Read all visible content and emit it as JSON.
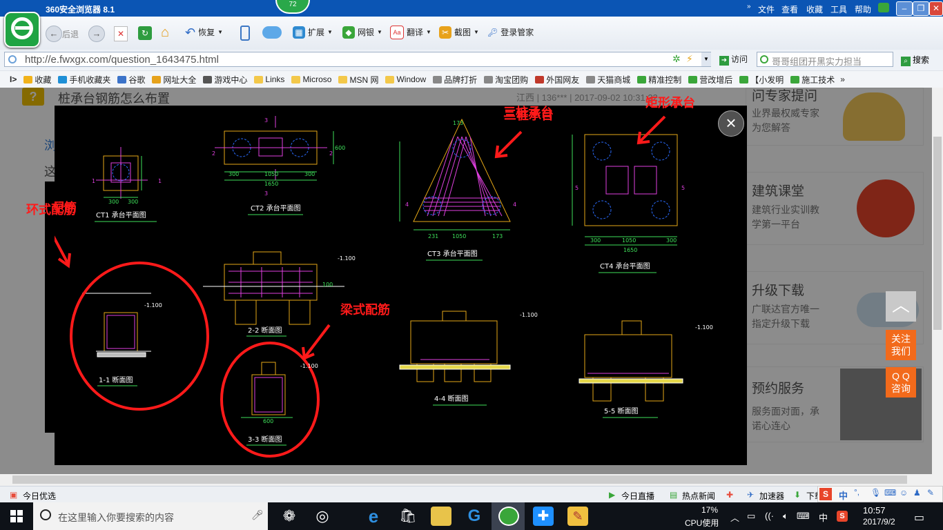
{
  "browser": {
    "title": "360安全浏览器 8.1",
    "badge": "72",
    "menu": [
      "文件",
      "查看",
      "收藏",
      "工具",
      "帮助"
    ],
    "nav": {
      "back": "后退",
      "restore": "恢复",
      "extend": "扩展",
      "bank": "网银",
      "translate": "翻译",
      "screenshot": "截图",
      "login": "登录管家"
    },
    "url": "http://e.fwxgx.com/question_1643475.html",
    "visit": "访问",
    "search_placeholder": "哥哥组团开黑实力担当",
    "search_btn": "搜索"
  },
  "bookmarks": [
    "收藏",
    "手机收藏夹",
    "谷歌",
    "网址大全",
    "游戏中心",
    "Links",
    "Microso",
    "MSN 网",
    "Window",
    "品牌打折",
    "淘宝团购",
    "外国网友",
    "天猫商城",
    "精准控制",
    "营改增后",
    "【小发明",
    "施工技术"
  ],
  "bookmark_colors": [
    "#f1b21a",
    "#1e8fd6",
    "#3b73c9",
    "#e6a21b",
    "#555555",
    "#f3c84a",
    "#f3c84a",
    "#f3c84a",
    "#f3c84a",
    "#888888",
    "#888888",
    "#c0392b",
    "#888888",
    "#3aa63a",
    "#3aa63a",
    "#3aa63a",
    "#3aa63a"
  ],
  "page": {
    "question": "桩承台钢筋怎么布置",
    "meta": "江西 | 136*** | 2017-09-02 10:31:32",
    "left_a": "浏",
    "left_b": "这",
    "side": [
      {
        "title": "问专家提问",
        "sub1": "业界最权威专家",
        "sub2": "为您解答"
      },
      {
        "title": "建筑课堂",
        "sub1": "建筑行业实训教",
        "sub2": "学第一平台"
      },
      {
        "title": "升级下载",
        "sub1": "广联达官方唯一",
        "sub2": "指定升级下载"
      },
      {
        "title": "预约服务",
        "sub1": "服务面对面，承",
        "sub2": "诺心连心"
      }
    ]
  },
  "drawing": {
    "annotations": {
      "ring": "环式配筋",
      "beam": "梁式配筋",
      "tri": "三桩承台",
      "rect": "矩形承台"
    },
    "labels": {
      "ct1": "CT1 承台平面图",
      "ct2": "CT2 承台平面图",
      "ct3": "CT3 承台平面图",
      "ct4": "CT4 承台平面图",
      "s11": "1-1 断面图",
      "s22": "2-2 断面图",
      "s33": "3-3 断面图",
      "s44": "4-4 断面图",
      "s55": "5-5 断面图"
    },
    "dims": {
      "d300": "300",
      "d1050": "1050",
      "d1650": "1650",
      "d600": "600",
      "d173": "173",
      "d231": "231",
      "d100": "100",
      "d1100": "-1.100",
      "d3": "3",
      "d2": "2",
      "d1": "1",
      "d4": "4",
      "d5": "5"
    }
  },
  "float": {
    "follow": "关注\n我们",
    "follow1": "关注",
    "follow2": "我们",
    "qq1": "Q Q",
    "qq2": "咨询"
  },
  "status": {
    "today": "今日优选",
    "live": "今日直播",
    "hot": "热点新闻",
    "speed": "加速器",
    "down": "下载",
    "ime": "中"
  },
  "taskbar": {
    "search": "在这里输入你要搜索的内容",
    "cpu": "17%",
    "cpu_label": "CPU使用",
    "lang": "中",
    "time": "10:57",
    "date": "2017/9/2"
  }
}
